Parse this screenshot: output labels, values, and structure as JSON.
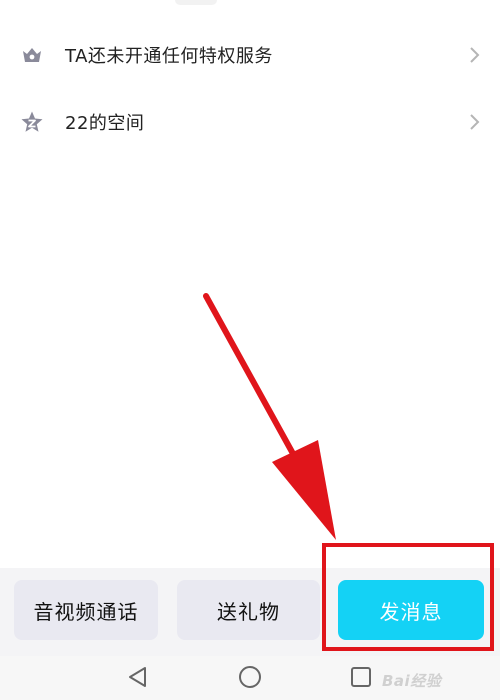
{
  "profile_rows": [
    {
      "label": "TA还未开通任何特权服务",
      "icon": "crown-icon"
    },
    {
      "label": "22的空间",
      "icon": "star-icon"
    }
  ],
  "actions": {
    "call_label": "音视频通话",
    "gift_label": "送礼物",
    "message_label": "发消息"
  },
  "nav": {
    "back_icon": "triangle-back-icon",
    "home_icon": "circle-home-icon",
    "recent_icon": "square-recent-icon"
  },
  "watermark": "Bai经验",
  "colors": {
    "accent": "#14d2f5",
    "annotation": "#e0151b",
    "icon_gray": "#8a8a9a",
    "text": "#222222"
  }
}
